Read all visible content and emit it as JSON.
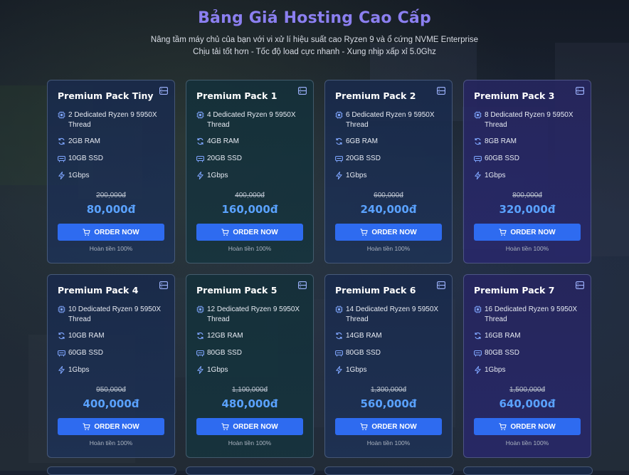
{
  "header": {
    "title": "Bảng Giá Hosting Cao Cấp",
    "subtitle_1": "Nâng tầm máy chủ của bạn với vi xử lí hiệu suất cao Ryzen 9 và ổ cứng NVME Enterprise",
    "subtitle_2": "Chịu tải tốt hơn - Tốc độ load cực nhanh - Xung nhịp xấp xỉ 5.0Ghz"
  },
  "common": {
    "order_label": "ORDER NOW",
    "refund_label": "Hoàn tiền 100%",
    "network": "1Gbps"
  },
  "icons": {
    "server": "server-icon",
    "cpu": "cpu-icon",
    "ram": "refresh-icon",
    "ssd": "disk-icon",
    "network": "lightning-icon",
    "cart": "cart-icon"
  },
  "colors": {
    "title": "#8b7ff0",
    "price": "#5aa2ff",
    "button": "#2e6bf0"
  },
  "plans": [
    {
      "name": "Premium Pack Tiny",
      "cpu": "2 Dedicated Ryzen 9 5950X Thread",
      "ram": "2GB RAM",
      "ssd": "10GB SSD",
      "network": "1Gbps",
      "old_price": "200,000đ",
      "price": "80,000đ"
    },
    {
      "name": "Premium Pack 1",
      "cpu": "4 Dedicated Ryzen 9 5950X Thread",
      "ram": "4GB RAM",
      "ssd": "20GB SSD",
      "network": "1Gbps",
      "old_price": "400,000đ",
      "price": "160,000đ"
    },
    {
      "name": "Premium Pack 2",
      "cpu": "6 Dedicated Ryzen 9 5950X Thread",
      "ram": "6GB RAM",
      "ssd": "20GB SSD",
      "network": "1Gbps",
      "old_price": "600,000đ",
      "price": "240,000đ"
    },
    {
      "name": "Premium Pack 3",
      "cpu": "8 Dedicated Ryzen 9 5950X Thread",
      "ram": "8GB RAM",
      "ssd": "60GB SSD",
      "network": "1Gbps",
      "old_price": "800,000đ",
      "price": "320,000đ"
    },
    {
      "name": "Premium Pack 4",
      "cpu": "10 Dedicated Ryzen 9 5950X Thread",
      "ram": "10GB RAM",
      "ssd": "60GB SSD",
      "network": "1Gbps",
      "old_price": "950,000đ",
      "price": "400,000đ"
    },
    {
      "name": "Premium Pack 5",
      "cpu": "12 Dedicated Ryzen 9 5950X Thread",
      "ram": "12GB RAM",
      "ssd": "80GB SSD",
      "network": "1Gbps",
      "old_price": "1,100,000đ",
      "price": "480,000đ"
    },
    {
      "name": "Premium Pack 6",
      "cpu": "14 Dedicated Ryzen 9 5950X Thread",
      "ram": "14GB RAM",
      "ssd": "80GB SSD",
      "network": "1Gbps",
      "old_price": "1,300,000đ",
      "price": "560,000đ"
    },
    {
      "name": "Premium Pack 7",
      "cpu": "16 Dedicated Ryzen 9 5950X Thread",
      "ram": "16GB RAM",
      "ssd": "80GB SSD",
      "network": "1Gbps",
      "old_price": "1,500,000đ",
      "price": "640,000đ"
    }
  ]
}
